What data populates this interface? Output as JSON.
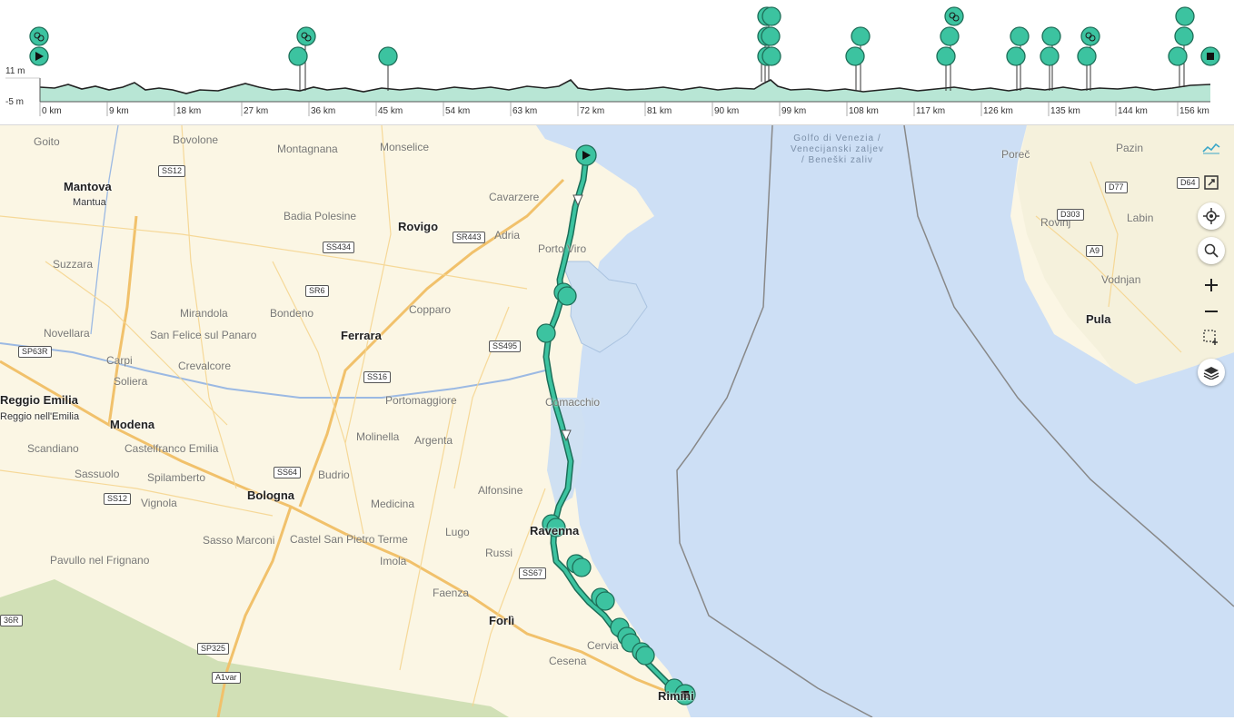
{
  "profile": {
    "elev_max": "11 m",
    "elev_min": "-5 m",
    "km_ticks": [
      "0 km",
      "9 km",
      "18 km",
      "27 km",
      "36 km",
      "45 km",
      "54 km",
      "63 km",
      "72 km",
      "81 km",
      "90 km",
      "99 km",
      "108 km",
      "117 km",
      "126 km",
      "135 km",
      "144 km",
      "156 km"
    ]
  },
  "map": {
    "cities": [
      "Mantova",
      "Mantua",
      "Rovigo",
      "Ferrara",
      "Reggio Emilia",
      "Reggio nell'Emilia",
      "Modena",
      "Bologna",
      "Forlì",
      "Ravenna",
      "Pula",
      "Rimini"
    ],
    "towns": [
      "Goito",
      "Bovolone",
      "Montagnana",
      "Monselice",
      "Cavarzere",
      "Badia Polesine",
      "Adria",
      "Porto Viro",
      "Suzzara",
      "Bondeno",
      "Copparo",
      "Novellara",
      "Mirandola",
      "San Felice sul Panaro",
      "Carpi",
      "Soliera",
      "Crevalcore",
      "Portomaggiore",
      "Comacchio",
      "Molinella",
      "Argenta",
      "Scandiano",
      "Castelfranco Emilia",
      "Sassuolo",
      "Spilamberto",
      "Vignola",
      "Budrio",
      "Medicina",
      "Alfonsine",
      "Lugo",
      "Castel San Pietro Terme",
      "Imola",
      "Russi",
      "Sasso Marconi",
      "Pavullo nel Frignano",
      "Faenza",
      "Cesena",
      "Cervia",
      "Rovinj",
      "Vodnjan",
      "Labin",
      "Poreč",
      "Pazin"
    ],
    "sea_name": [
      "Golfo di Venezia /",
      "Venecijanski zaljev",
      "/ Beneški zaliv"
    ],
    "roads": [
      "SS12",
      "SS434",
      "SR443",
      "SR6",
      "SS495",
      "SS16",
      "SP63R",
      "SS64",
      "SS12",
      "SS67",
      "SP325",
      "A1var",
      "36R",
      "D77",
      "D64",
      "D303",
      "A9"
    ]
  },
  "controls": [
    "elevation-profile-toggle",
    "fullscreen",
    "locate",
    "search",
    "zoom-in",
    "zoom-out",
    "area-select",
    "layers"
  ],
  "colors": {
    "route": "#2fa487",
    "route_border": "#1c6e58",
    "land": "#fbf6e4",
    "sea": "#cdddf4",
    "profile_fill": "#b8e6d5",
    "forest": "#c9dcae"
  }
}
